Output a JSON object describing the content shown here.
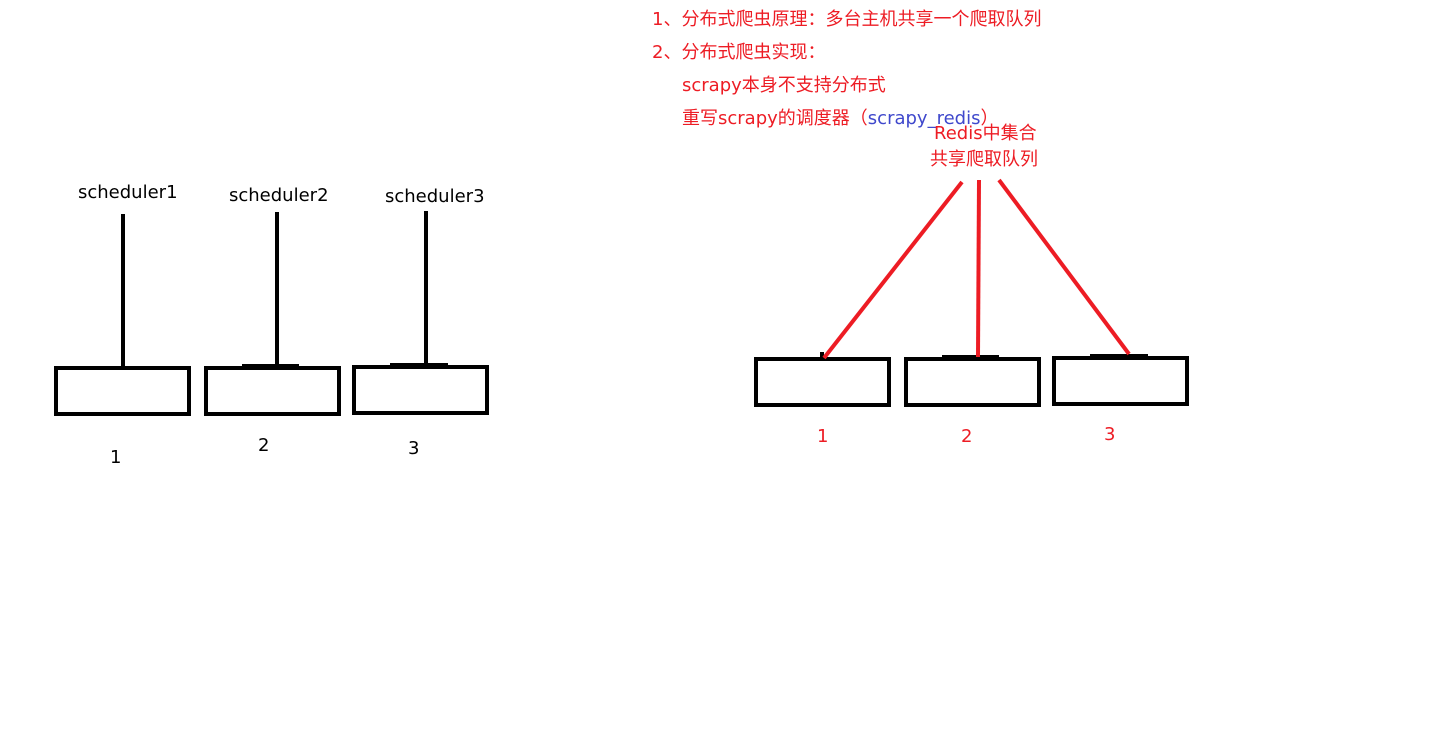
{
  "notes": {
    "line1": "1、分布式爬虫原理：多台主机共享一个爬取队列",
    "line2": "2、分布式爬虫实现：",
    "line3": "scrapy本身不支持分布式",
    "line4_prefix": "重写scrapy的调度器（",
    "line4_code": "scrapy_redis",
    "line4_suffix": "）"
  },
  "left_diagram": {
    "schedulers": [
      "scheduler1",
      "scheduler2",
      "scheduler3"
    ],
    "hosts": [
      "1",
      "2",
      "3"
    ]
  },
  "right_diagram": {
    "queue_label_line1": "Redis中集合",
    "queue_label_line2": "共享爬取队列",
    "hosts": [
      "1",
      "2",
      "3"
    ]
  },
  "colors": {
    "black": "#000000",
    "red": "#ed1c24",
    "blue": "#3f48cc"
  }
}
